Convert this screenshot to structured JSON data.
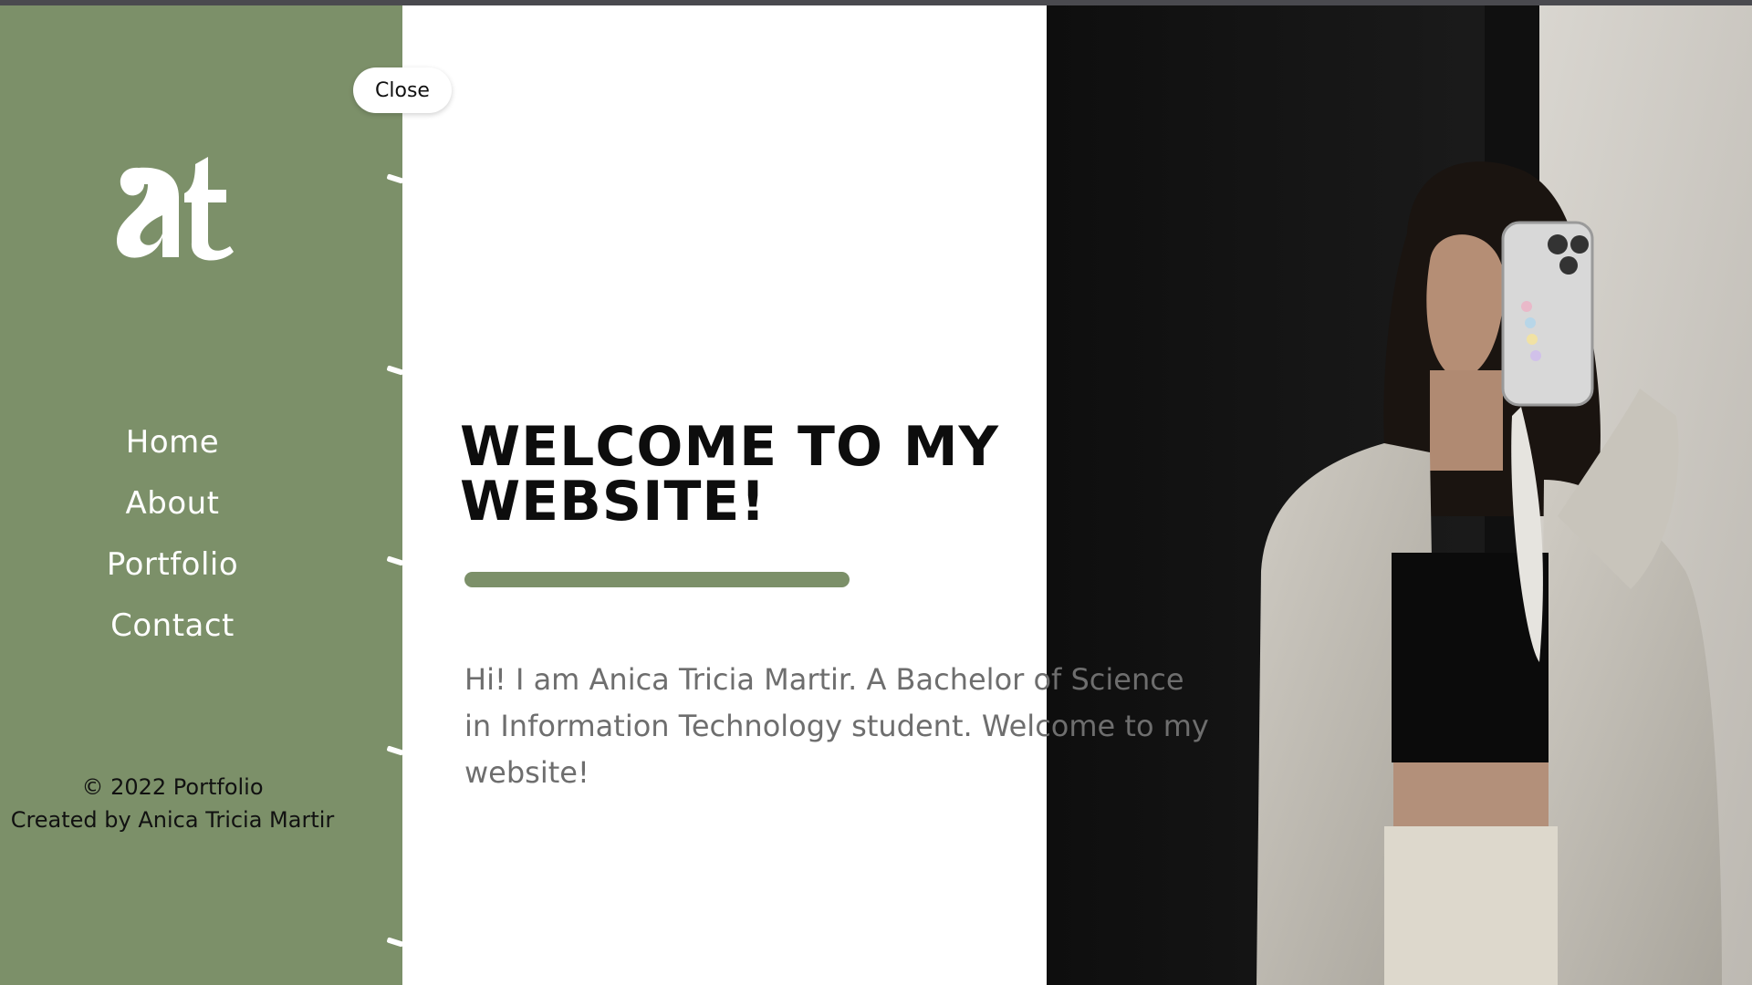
{
  "close": {
    "label": "Close"
  },
  "nav": {
    "items": [
      {
        "label": "Home"
      },
      {
        "label": "About"
      },
      {
        "label": "Portfolio"
      },
      {
        "label": "Contact"
      }
    ]
  },
  "footer": {
    "line1": "© 2022 Portfolio",
    "line2": "Created by Anica Tricia Martir"
  },
  "hero": {
    "heading": "WELCOME TO MY WEBSITE!",
    "intro": "Hi! I am Anica Tricia Martir. A Bachelor of Science in Information Technology student. Welcome to my website!"
  },
  "logo": {
    "text": "at"
  },
  "colors": {
    "sage": "#7c9069",
    "white": "#ffffff",
    "heading": "#0d0d0d",
    "body_text": "#6e6e6e"
  }
}
